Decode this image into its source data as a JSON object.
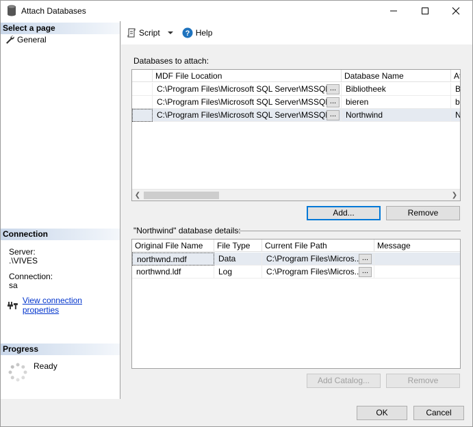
{
  "window": {
    "title": "Attach Databases"
  },
  "left": {
    "select_page_header": "Select a page",
    "nav_general": "General",
    "connection_header": "Connection",
    "server_label": "Server:",
    "server_value": ".\\VIVES",
    "connection_label": "Connection:",
    "connection_value": "sa",
    "view_connection_link": "View connection properties",
    "progress_header": "Progress",
    "progress_status": "Ready"
  },
  "toolbar": {
    "script_label": "Script",
    "help_label": "Help"
  },
  "attach": {
    "label": "Databases to attach:",
    "columns": [
      "MDF File Location",
      "Database Name",
      "At"
    ],
    "rows": [
      {
        "location": "C:\\Program Files\\Microsoft SQL Server\\MSSQL...",
        "ellipsis": "...",
        "name": "Bibliotheek",
        "attach_as": "Bi"
      },
      {
        "location": "C:\\Program Files\\Microsoft SQL Server\\MSSQL...",
        "ellipsis": "...",
        "name": "bieren",
        "attach_as": "bi"
      },
      {
        "location": "C:\\Program Files\\Microsoft SQL Server\\MSSQL...",
        "ellipsis": "...",
        "name": "Northwind",
        "attach_as": "N"
      }
    ],
    "add_button": "Add...",
    "remove_button": "Remove"
  },
  "details": {
    "label": "\"Northwind\" database details:",
    "columns": [
      "Original File Name",
      "File Type",
      "Current File Path",
      "Message"
    ],
    "rows": [
      {
        "file": "northwnd.mdf",
        "type": "Data",
        "path": "C:\\Program Files\\Micros...",
        "ellipsis": "...",
        "message": ""
      },
      {
        "file": "northwnd.ldf",
        "type": "Log",
        "path": "C:\\Program Files\\Micros...",
        "ellipsis": "...",
        "message": ""
      }
    ],
    "add_catalog_button": "Add Catalog...",
    "remove_button": "Remove"
  },
  "footer": {
    "ok_button": "OK",
    "cancel_button": "Cancel"
  },
  "colors": {
    "section_header": "#c9d7ea",
    "link": "#0033cc",
    "selected_row": "#e5eaf1",
    "primary_border": "#0078d7"
  }
}
